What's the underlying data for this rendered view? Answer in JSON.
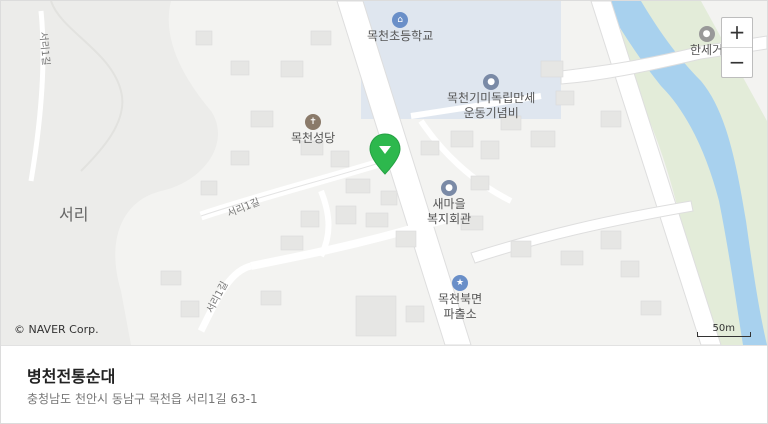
{
  "map": {
    "pois": [
      {
        "name": "목천초등학교",
        "icon": "school-icon",
        "color": "#6a8fc8"
      },
      {
        "name": "목천기미독립만세\n운동기념비",
        "icon": "monument-icon",
        "color": "#7a8aa6"
      },
      {
        "name": "목천성당",
        "icon": "church-icon",
        "color": "#8a7a6a"
      },
      {
        "name": "새마을\n복지회관",
        "icon": "public-building-icon",
        "color": "#7a8aa6"
      },
      {
        "name": "목천북면\n파출소",
        "icon": "police-icon",
        "color": "#6a8fc8"
      },
      {
        "name": "한세거",
        "icon": "place-icon",
        "color": "#999999"
      }
    ],
    "area_label": "서리",
    "road_labels": [
      "서리1길",
      "서리1길",
      "서리1길"
    ],
    "copyright": "© NAVER Corp.",
    "scale_label": "50m",
    "zoom_in": "+",
    "zoom_out": "−",
    "marker_color": "#2db84d"
  },
  "info": {
    "name": "병천전통순대",
    "address": "충청남도 천안시 동남구 목천읍 서리1길 63-1"
  }
}
